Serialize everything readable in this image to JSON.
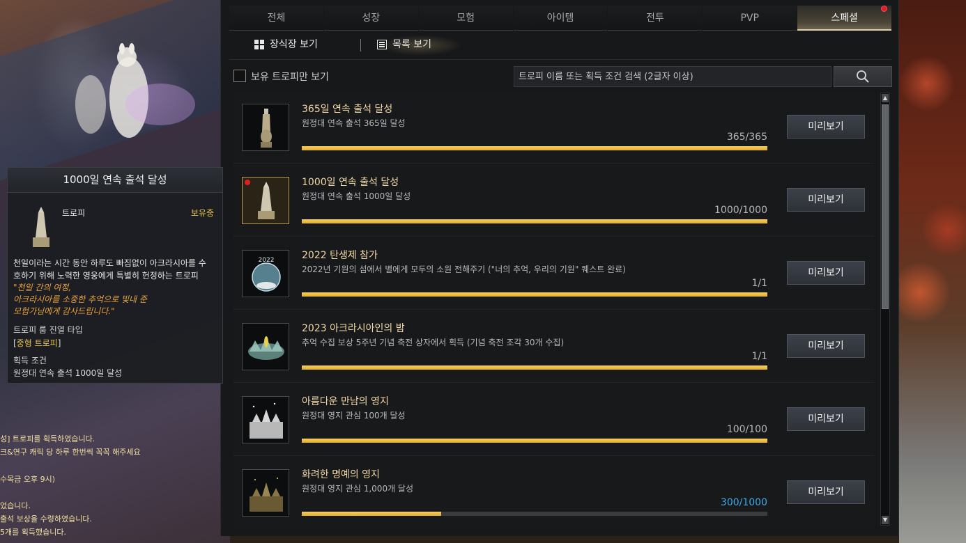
{
  "tabs": [
    {
      "label": "전체",
      "active": false
    },
    {
      "label": "성장",
      "active": false
    },
    {
      "label": "모험",
      "active": false
    },
    {
      "label": "아이템",
      "active": false
    },
    {
      "label": "전투",
      "active": false
    },
    {
      "label": "PVP",
      "active": false
    },
    {
      "label": "스페셜",
      "active": true,
      "badge": true
    }
  ],
  "view": {
    "showcase_label": "장식장 보기",
    "list_label": "목록 보기"
  },
  "filter": {
    "owned_only_label": "보유 트로피만 보기",
    "owned_only_checked": false,
    "search_placeholder": "트로피 이름 또는 획득 조건 검색 (2글자 이상)"
  },
  "trophies": [
    {
      "title": "365일 연속 출석 달성",
      "desc": "원정대 연속 출석 365일 달성",
      "count": "365/365",
      "progress": 1.0,
      "count_color": "normal",
      "new": false,
      "button": "미리보기"
    },
    {
      "title": "1000일 연속 출석 달성",
      "desc": "원정대 연속 출석 1000일 달성",
      "count": "1000/1000",
      "progress": 1.0,
      "count_color": "normal",
      "new": true,
      "button": "미리보기"
    },
    {
      "title": "2022 탄생제 참가",
      "desc": "2022년 기원의 섬에서 별에게 모두의 소원 전해주기 (\"너의 추억, 우리의 기원\" 퀘스트 완료)",
      "count": "1/1",
      "progress": 1.0,
      "count_color": "normal",
      "new": false,
      "button": "미리보기"
    },
    {
      "title": "2023 아크라시아인의 밤",
      "desc": "추억 수집 보상 5주년 기념 축전 상자에서 획득 (기념 축전 조각 30개 수집)",
      "count": "1/1",
      "progress": 1.0,
      "count_color": "normal",
      "new": false,
      "button": "미리보기"
    },
    {
      "title": "아름다운 만남의 영지",
      "desc": "원정대 영지 관심 100개 달성",
      "count": "100/100",
      "progress": 1.0,
      "count_color": "normal",
      "new": false,
      "button": "미리보기"
    },
    {
      "title": "화려한 명예의 영지",
      "desc": "원정대 영지 관심 1,000개 달성",
      "count": "300/1000",
      "progress": 0.3,
      "count_color": "blue",
      "new": false,
      "button": "미리보기"
    }
  ],
  "tooltip": {
    "title": "1000일 연속 출석 달성",
    "type": "트로피",
    "status": "보유중",
    "desc_line1": "천일이라는 시간 동안 하루도 빠짐없이 아크라시아를 수",
    "desc_line2": "호하기 위해 노력한 영웅에게 특별히 헌정하는 트로피",
    "quote_line1": "\"천일 간의 여정,",
    "quote_line2": "아크라시아를 소중한 추억으로 빛내 준",
    "quote_line3": "모험가님에게 감사드립니다.\"",
    "display_type_label": "트로피 룸 진열 타입",
    "display_type_value": "[중형 트로피]",
    "display_type_inner": "중형 트로피",
    "condition_label": "획득 조건",
    "condition_value": "원정대 연속 출석 1000일 달성"
  },
  "chat": {
    "line1": "성] 트로피를 획득하였습니다.",
    "line2": "크&연구 캐릭 당 하루 한번씩 꼭꼭 해주세요",
    "line3": "수목금 오후 9시)",
    "line4": "었습니다.",
    "line5": " 출석 보상을 수령하였습니다.",
    "line6": " 5개를 획득했습니다."
  },
  "colors": {
    "accent_gold": "#e8c24a",
    "title_gold": "#f2d9a8",
    "progress_blue": "#3fa9e6",
    "badge_red": "#e02020"
  }
}
